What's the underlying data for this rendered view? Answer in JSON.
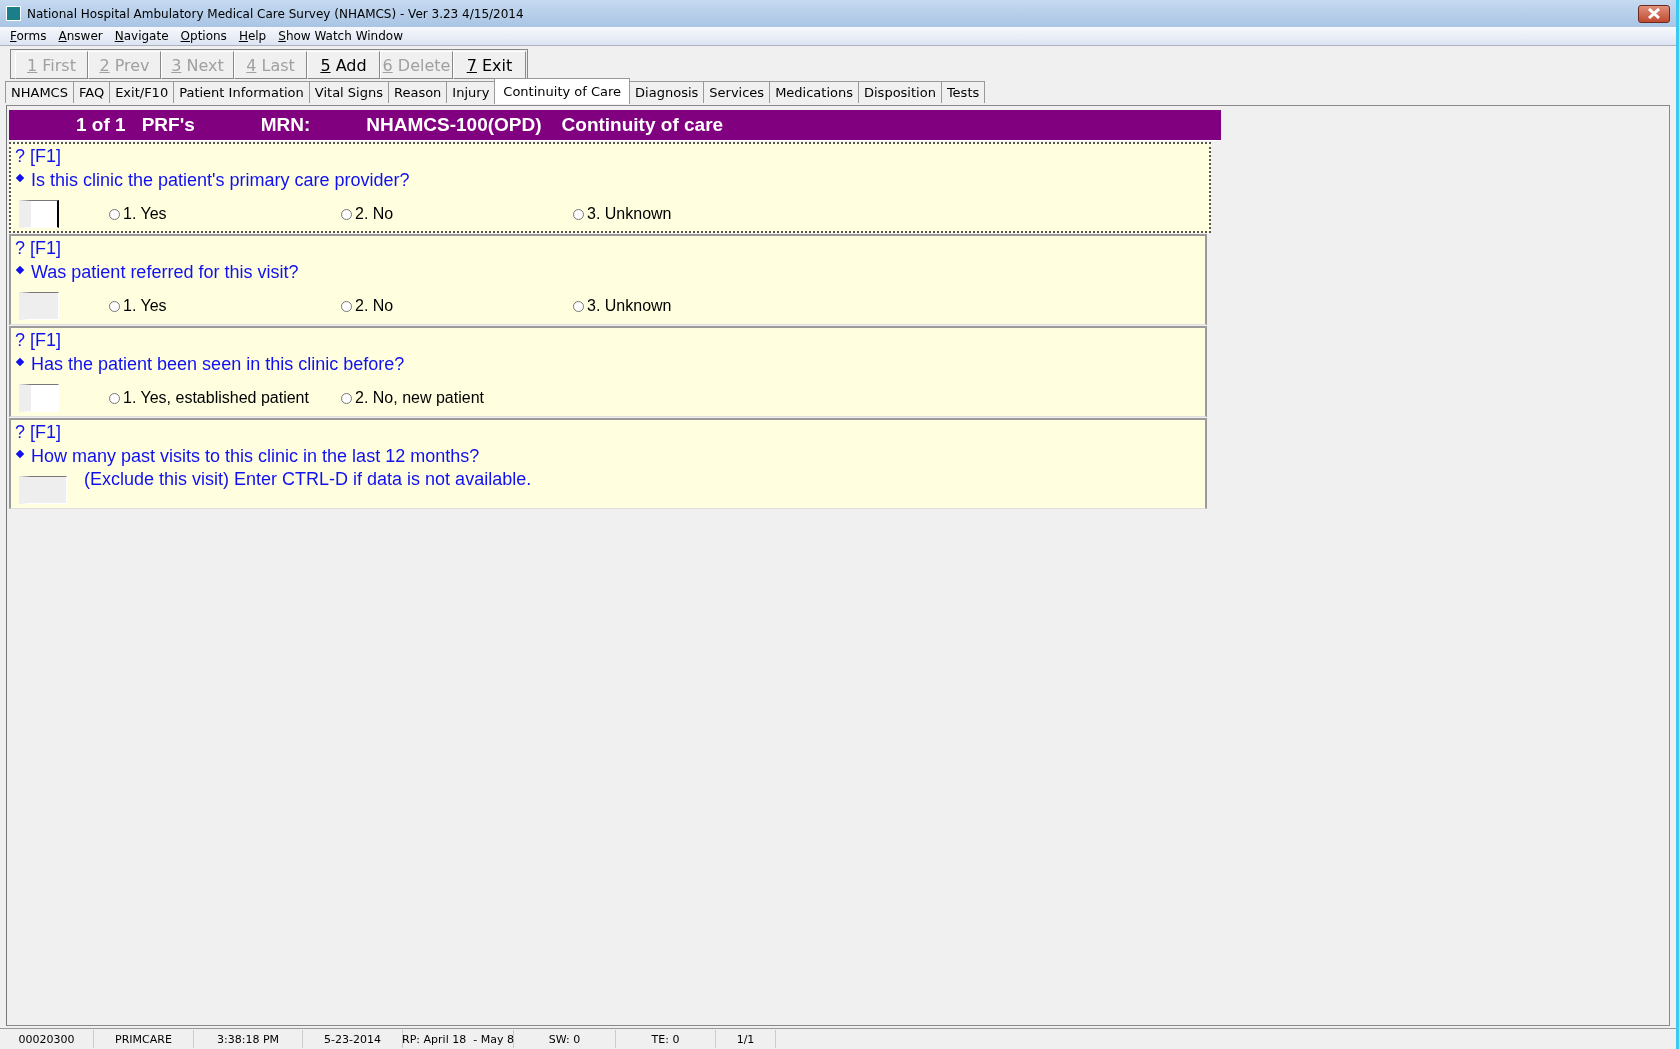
{
  "window": {
    "title": "National Hospital Ambulatory Medical Care Survey (NHAMCS) - Ver 3.23 4/15/2014"
  },
  "menu": [
    "Forms",
    "Answer",
    "Navigate",
    "Options",
    "Help",
    "Show Watch Window"
  ],
  "toolbar": [
    {
      "key": "1",
      "label": "First",
      "disabled": true
    },
    {
      "key": "2",
      "label": "Prev",
      "disabled": true
    },
    {
      "key": "3",
      "label": "Next",
      "disabled": true
    },
    {
      "key": "4",
      "label": "Last",
      "disabled": true
    },
    {
      "key": "5",
      "label": "Add",
      "disabled": false
    },
    {
      "key": "6",
      "label": "Delete",
      "disabled": true
    },
    {
      "key": "7",
      "label": "Exit",
      "disabled": false
    }
  ],
  "tabs": [
    {
      "label": "NHAMCS",
      "selected": false
    },
    {
      "label": "FAQ",
      "selected": false
    },
    {
      "label": "Exit/F10",
      "selected": false
    },
    {
      "label": "Patient Information",
      "selected": false
    },
    {
      "label": "Vital Signs",
      "selected": false
    },
    {
      "label": "Reason",
      "selected": false
    },
    {
      "label": "Injury",
      "selected": false
    },
    {
      "label": "Continuity of Care",
      "selected": true
    },
    {
      "label": "Diagnosis",
      "selected": false
    },
    {
      "label": "Services",
      "selected": false
    },
    {
      "label": "Medications",
      "selected": false
    },
    {
      "label": "Disposition",
      "selected": false
    },
    {
      "label": "Tests",
      "selected": false
    }
  ],
  "header": {
    "count": "1 of 1",
    "form": "PRF's",
    "mrn_label": "MRN:",
    "mrn": "NHAMCS-100(OPD)",
    "section": "Continuity of care"
  },
  "questions": [
    {
      "kind": "choice",
      "help": "? [F1]",
      "text": "Is this clinic the patient's primary care provider?",
      "focused": true,
      "options": [
        {
          "label": "1. Yes",
          "selected": false
        },
        {
          "label": "2. No",
          "selected": false
        },
        {
          "label": "3. Unknown",
          "selected": false
        }
      ]
    },
    {
      "kind": "choice",
      "help": "? [F1]",
      "text": "Was patient referred for this visit?",
      "focused": false,
      "options": [
        {
          "label": "1. Yes",
          "selected": false
        },
        {
          "label": "2. No",
          "selected": false
        },
        {
          "label": "3. Unknown",
          "selected": false
        }
      ]
    },
    {
      "kind": "choice",
      "help": "? [F1]",
      "text": "Has the patient been seen in this clinic before?",
      "focused": false,
      "options": [
        {
          "label": "1. Yes, established patient",
          "selected": false
        },
        {
          "label": "2. No, new patient",
          "selected": false
        }
      ]
    },
    {
      "kind": "number",
      "help": "? [F1]",
      "text": "How many past visits to this clinic in the last 12 months?",
      "note": "(Exclude this visit) Enter CTRL-D if data is not available.",
      "focused": false
    }
  ],
  "status_bar": [
    "00020300",
    "PRIMCARE",
    "3:38:18 PM",
    "5-23-2014",
    "RP: April 18  - May 8",
    "SW: 0",
    "TE: 0",
    "1/1"
  ]
}
